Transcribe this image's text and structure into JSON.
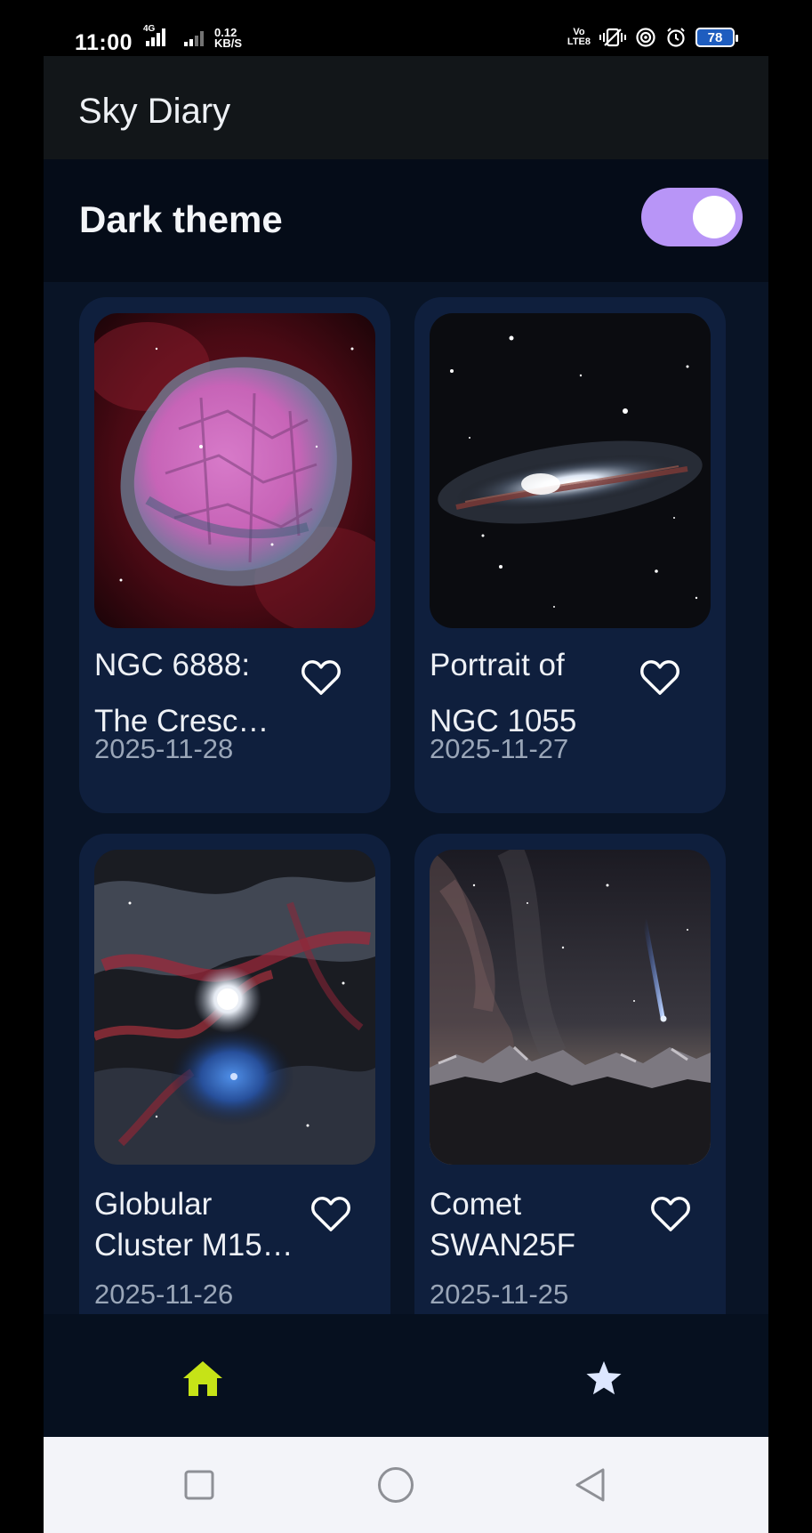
{
  "status_bar": {
    "time": "11:00",
    "network_label": "4G",
    "speed_value": "0.12",
    "speed_unit": "KB/S",
    "volte_top": "Vo",
    "volte_bottom": "LTE8",
    "battery": "78",
    "icons": [
      "signal-icon",
      "signal-icon",
      "vibrate-icon",
      "hotspot-icon",
      "alarm-icon",
      "battery-icon"
    ]
  },
  "app_bar": {
    "title": "Sky Diary"
  },
  "settings": {
    "dark_theme_label": "Dark theme",
    "dark_theme_on": true
  },
  "cards": [
    {
      "title_line1": "NGC 6888:",
      "title_line2": "The Cresc…",
      "date": "2025-11-28",
      "favorite": false,
      "image": "crescent-nebula-image"
    },
    {
      "title_line1": "Portrait of",
      "title_line2": "NGC 1055",
      "date": "2025-11-27",
      "favorite": false,
      "image": "galaxy-image"
    },
    {
      "title_line1": "Globular",
      "title_line2": "Cluster M15…",
      "date": "2025-11-26",
      "favorite": false,
      "image": "globular-cluster-image"
    },
    {
      "title_line1": "Comet",
      "title_line2": "SWAN25F",
      "date": "2025-11-25",
      "favorite": false,
      "image": "comet-image"
    }
  ],
  "bottom_nav": {
    "items": [
      {
        "icon": "home-icon",
        "active": true
      },
      {
        "icon": "star-icon",
        "active": false
      }
    ]
  },
  "colors": {
    "accent": "#b895f7",
    "active_nav": "#c6e317",
    "card_bg": "#0f1f3d",
    "background": "#06101f"
  }
}
